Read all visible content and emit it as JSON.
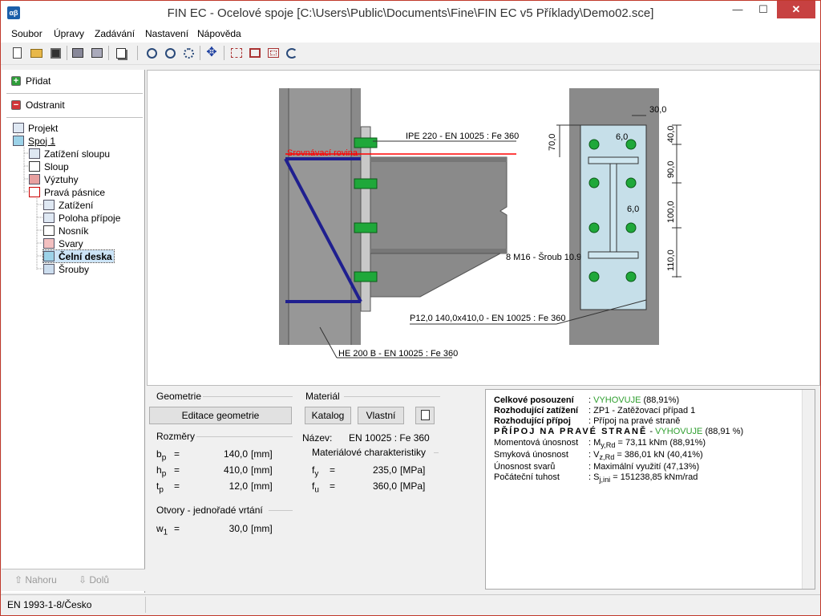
{
  "window": {
    "title": "FIN EC - Ocelové spoje [C:\\Users\\Public\\Documents\\Fine\\FIN EC v5 Příklady\\Demo02.sce]",
    "min": "—",
    "max": "☐",
    "close": "✕",
    "app_icon": "αβ"
  },
  "menu": [
    "Soubor",
    "Úpravy",
    "Zadávání",
    "Nastavení",
    "Nápověda"
  ],
  "left": {
    "add": "Přidat",
    "remove": "Odstranit",
    "tree": [
      "Projekt",
      "Spoj 1",
      "Zatížení sloupu",
      "Sloup",
      "Výztuhy",
      "Pravá pásnice",
      "Zatížení",
      "Poloha přípoje",
      "Nosník",
      "Svary",
      "Čelní deska",
      "Šrouby"
    ],
    "up": "Nahoru",
    "down": "Dolů"
  },
  "drawing": {
    "beam_label": "IPE 220 - EN 10025 : Fe 360",
    "ref_line": "Srovnávací rovina",
    "column_label": "HE 200 B - EN 10025 : Fe 360",
    "bolt_label": "8 M16 - Šroub 10.9",
    "plate_label": "P12,0 140,0x410,0 - EN 10025 : Fe 360",
    "dims": [
      "30,0",
      "70,0",
      "40,0",
      "90,0",
      "100,0",
      "110,0",
      "6,0",
      "6,0"
    ]
  },
  "geometry": {
    "group_title": "Geometrie",
    "edit_button": "Editace geometrie",
    "dims_title": "Rozměry",
    "bp_sym": "b",
    "bp_sub": "p",
    "bp_val": "140,0",
    "hp_sym": "h",
    "hp_sub": "p",
    "hp_val": "410,0",
    "tp_sym": "t",
    "tp_sub": "p",
    "tp_val": "12,0",
    "unit": "[mm]",
    "eq": "=",
    "holes_title": "Otvory - jednořadé vrtání",
    "w1_sym": "w",
    "w1_sub": "1",
    "w1_val": "30,0"
  },
  "material": {
    "group_title": "Materiál",
    "catalog": "Katalog",
    "own": "Vlastní",
    "name_label": "Název:",
    "name_value": "EN 10025 : Fe 360",
    "chars_title": "Materiálové charakteristiky",
    "fy_sym": "f",
    "fy_sub": "y",
    "fy_val": "235,0",
    "fu_sym": "f",
    "fu_sub": "u",
    "fu_val": "360,0",
    "unit": "[MPa]"
  },
  "results": {
    "r1_label": "Celkové posouzení",
    "r1_prefix": ": ",
    "r1_ok": "VYHOVUJE",
    "r1_rest": " (88,91%)",
    "r2_label": "Rozhodující zatížení",
    "r2_value": ": ZP1 - Zatěžovací případ 1",
    "r3_label": "Rozhodující přípoj",
    "r3_value": ": Přípoj na pravé straně",
    "r4_label": "PŘÍPOJ NA PRAVÉ STRANĚ",
    "r4_sep": " - ",
    "r4_ok": "VYHOVUJE",
    "r4_rest": " (88,91 %)",
    "r5_label": "Momentová únosnost",
    "r5_pre": ": M",
    "r5_sub": "y,Rd",
    "r5_post": " = 73,11 kNm  (88,91%)",
    "r6_label": "Smyková únosnost",
    "r6_pre": ": V",
    "r6_sub": "z,Rd",
    "r6_post": " = 386,01 kN  (40,41%)",
    "r7_label": "Únosnost svarů",
    "r7_value": ": Maximální využití  (47,13%)",
    "r8_label": "Počáteční tuhost",
    "r8_pre": ": S",
    "r8_sub": "j,ini",
    "r8_post": " = 151238,85 kNm/rad"
  },
  "status": {
    "norm": "EN 1993-1-8/Česko"
  },
  "colors": {
    "accent": "#1f1f8f",
    "ok": "#2e9e2e",
    "bolt": "#1fa83a",
    "ref": "#ff0000"
  }
}
